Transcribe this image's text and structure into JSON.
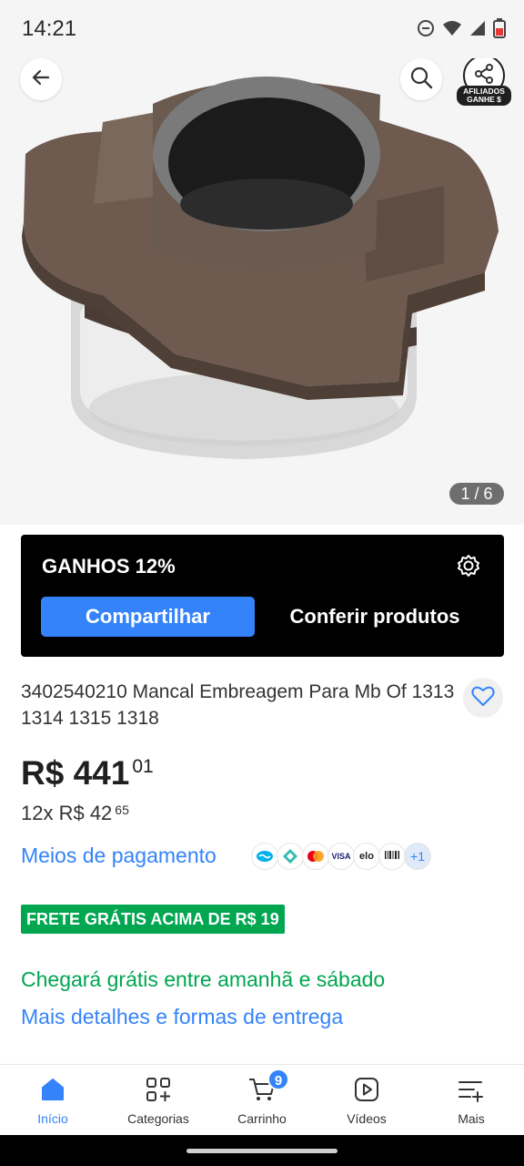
{
  "status_bar": {
    "time": "14:21"
  },
  "gallery": {
    "counter": "1 / 6"
  },
  "affiliates": {
    "badge_line1": "AFILIADOS",
    "badge_line2": "GANHE $",
    "title": "GANHOS 12%",
    "share_label": "Compartilhar",
    "check_label": "Conferir produtos"
  },
  "product": {
    "title": "3402540210 Mancal Embreagem Para Mb Of 1313 1314 1315 1318",
    "price_main": "R$ 441",
    "price_cents": "01",
    "installments_main": "12x R$ 42",
    "installments_cents": "65"
  },
  "payment": {
    "link_label": "Meios de pagamento",
    "icons": [
      "mercado-pago-icon",
      "pix-icon",
      "mastercard-icon",
      "visa-icon",
      "elo-icon",
      "boleto-icon"
    ],
    "visa_text": "VISA",
    "elo_text": "elo",
    "more_label": "+1"
  },
  "shipping": {
    "badge": "FRETE GRÁTIS ACIMA DE R$ 19",
    "arrival": "Chegará grátis entre amanhã e sábado",
    "details_link": "Mais detalhes e formas de entrega"
  },
  "nav": {
    "items": [
      {
        "label": "Início"
      },
      {
        "label": "Categorias"
      },
      {
        "label": "Carrinho"
      },
      {
        "label": "Vídeos"
      },
      {
        "label": "Mais"
      }
    ],
    "cart_count": "9"
  },
  "colors": {
    "accent_blue": "#3483fa",
    "green": "#00a650",
    "card_black": "#000000"
  }
}
